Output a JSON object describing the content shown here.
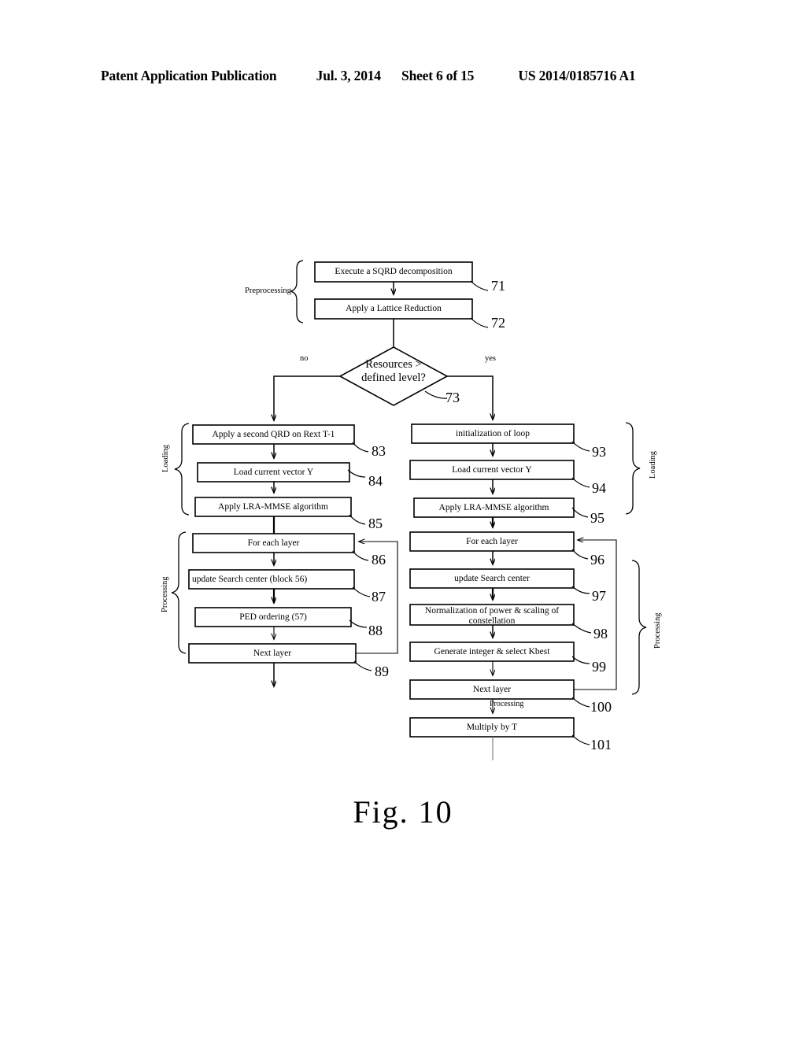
{
  "header": {
    "publication": "Patent Application Publication",
    "date": "Jul. 3, 2014",
    "sheet": "Sheet 6 of 15",
    "number": "US 2014/0185716 A1"
  },
  "figure": {
    "caption": "Fig.  10",
    "decision": {
      "text": "Resources >\ndefined level?",
      "ref": "73",
      "no_label": "no",
      "yes_label": "yes"
    },
    "group_labels": {
      "preprocessing": "Preprocessing",
      "left_loading": "Loading",
      "left_processing": "Processing",
      "right_loading": "Loading",
      "right_processing": "Processing"
    },
    "inline_notes": {
      "next_layer_processing": "Processing"
    },
    "boxes": {
      "preprocessing": [
        {
          "id": "b71",
          "label": "Execute a SQRD decomposition",
          "ref": "71"
        },
        {
          "id": "b72",
          "label": "Apply a Lattice Reduction",
          "ref": "72"
        }
      ],
      "left_branch": [
        {
          "id": "b83",
          "label": "Apply a second QRD on Rext T-1",
          "ref": "83"
        },
        {
          "id": "b84",
          "label": "Load current vector Y",
          "ref": "84"
        },
        {
          "id": "b85",
          "label": "Apply LRA-MMSE algorithm",
          "ref": "85"
        },
        {
          "id": "b86",
          "label": "For each layer",
          "ref": "86"
        },
        {
          "id": "b87",
          "label": "update Search center (block 56)",
          "ref": "87"
        },
        {
          "id": "b88",
          "label": "PED ordering (57)",
          "ref": "88"
        },
        {
          "id": "b89",
          "label": "Next layer",
          "ref": "89"
        }
      ],
      "right_branch": [
        {
          "id": "b93",
          "label": "initialization of loop",
          "ref": "93"
        },
        {
          "id": "b94",
          "label": "Load current vector Y",
          "ref": "94"
        },
        {
          "id": "b95",
          "label": "Apply LRA-MMSE algorithm",
          "ref": "95"
        },
        {
          "id": "b96",
          "label": "For each layer",
          "ref": "96"
        },
        {
          "id": "b97",
          "label": "update Search center",
          "ref": "97"
        },
        {
          "id": "b98",
          "label": "Normalization of power & scaling of\nconstellation",
          "ref": "98"
        },
        {
          "id": "b99",
          "label": "Generate integer & select Kbest",
          "ref": "99"
        },
        {
          "id": "b100",
          "label": "Next layer",
          "ref": "100"
        },
        {
          "id": "b101",
          "label": "Multiply by T",
          "ref": "101"
        }
      ]
    }
  }
}
